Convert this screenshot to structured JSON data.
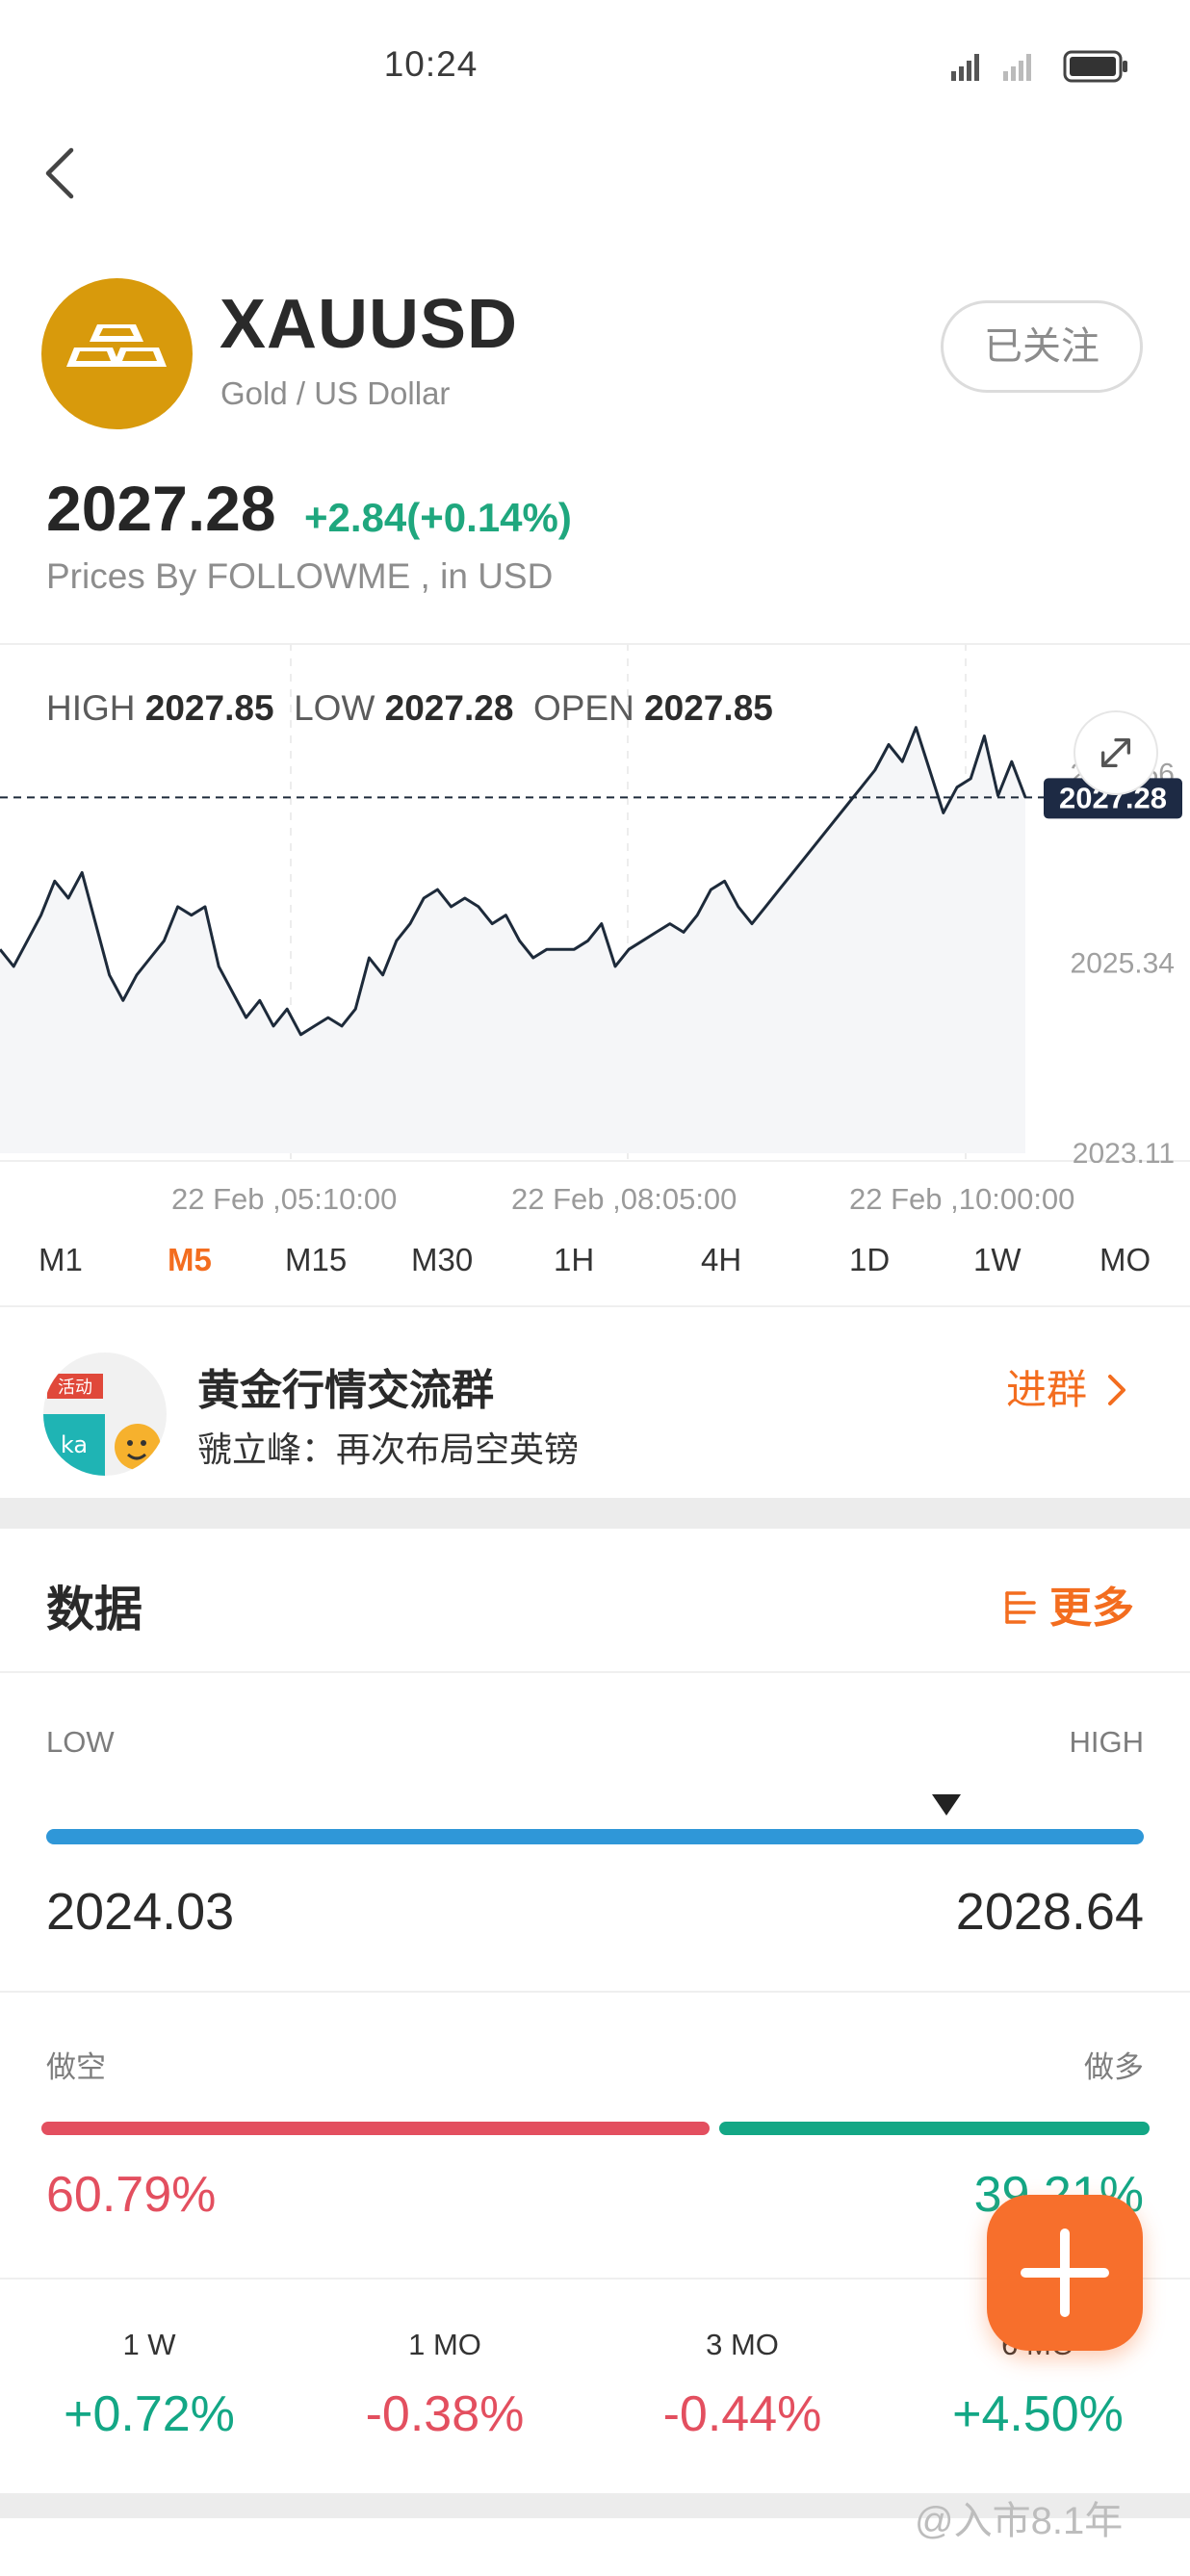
{
  "status": {
    "time": "10:24"
  },
  "header": {
    "symbol": "XAUUSD",
    "name": "Gold / US Dollar",
    "follow_label": "已关注",
    "price": "2027.28",
    "change": "+2.84(+0.14%)",
    "price_note": "Prices By FOLLOWME , in USD"
  },
  "chart": {
    "high_label": "HIGH",
    "high_value": "2027.85",
    "low_label": "LOW",
    "low_value": "2027.28",
    "open_label": "OPEN",
    "open_value": "2027.85",
    "current_tag": "2027.28",
    "y_ticks": [
      "2027.56",
      "2025.34",
      "2023.11"
    ],
    "x_ticks": [
      "22 Feb ,05:10:00",
      "22 Feb ,08:05:00",
      "22 Feb ,10:00:00"
    ],
    "timeframes": [
      "M1",
      "M5",
      "M15",
      "M30",
      "1H",
      "4H",
      "1D",
      "1W",
      "MO"
    ],
    "active_timeframe": "M5"
  },
  "chart_data": {
    "type": "line",
    "ylim": [
      2023.11,
      2028.3
    ],
    "last": 2027.28,
    "values": [
      2025.5,
      2025.3,
      2025.6,
      2025.9,
      2026.3,
      2026.1,
      2026.4,
      2025.8,
      2025.2,
      2024.9,
      2025.2,
      2025.4,
      2025.6,
      2026.0,
      2025.9,
      2026.0,
      2025.3,
      2025.0,
      2024.7,
      2024.9,
      2024.6,
      2024.8,
      2024.5,
      2024.6,
      2024.7,
      2024.6,
      2024.8,
      2025.4,
      2025.2,
      2025.6,
      2025.8,
      2026.1,
      2026.2,
      2026.0,
      2026.1,
      2026.0,
      2025.8,
      2025.9,
      2025.6,
      2025.4,
      2025.5,
      2025.5,
      2025.5,
      2025.6,
      2025.8,
      2025.3,
      2025.5,
      2025.6,
      2025.7,
      2025.8,
      2025.7,
      2025.9,
      2026.2,
      2026.3,
      2026.0,
      2025.8,
      2026.0,
      2026.2,
      2026.4,
      2026.6,
      2026.8,
      2027.0,
      2027.2,
      2027.4,
      2027.6,
      2027.9,
      2027.7,
      2028.1,
      2027.6,
      2027.1,
      2027.4,
      2027.5,
      2028.0,
      2027.3,
      2027.7,
      2027.28
    ]
  },
  "group": {
    "avatar_tag": "活动",
    "avatar_text": "ka",
    "name": "黄金行情交流群",
    "message": "虢立峰：再次布局空英镑",
    "join_label": "进群"
  },
  "data_section": {
    "title": "数据",
    "more_label": "更多",
    "low_label": "LOW",
    "high_label": "HIGH",
    "range_low": "2024.03",
    "range_high": "2028.64",
    "range_position": 0.82,
    "short_label": "做空",
    "long_label": "做多",
    "short_pct": "60.79%",
    "long_pct": "39.21%",
    "short_ratio": 0.6079,
    "periods": [
      {
        "label": "1 W",
        "value": "+0.72%"
      },
      {
        "label": "1 MO",
        "value": "-0.38%"
      },
      {
        "label": "3 MO",
        "value": "-0.44%"
      },
      {
        "label": "6 MO",
        "value": "+4.50%"
      }
    ]
  },
  "watermark": "@入市8.1年",
  "colors": {
    "accent": "#f36d1f",
    "up": "#1fa77e",
    "down": "#e34f5f",
    "range": "#2f97d8",
    "gold": "#d89a0c"
  }
}
